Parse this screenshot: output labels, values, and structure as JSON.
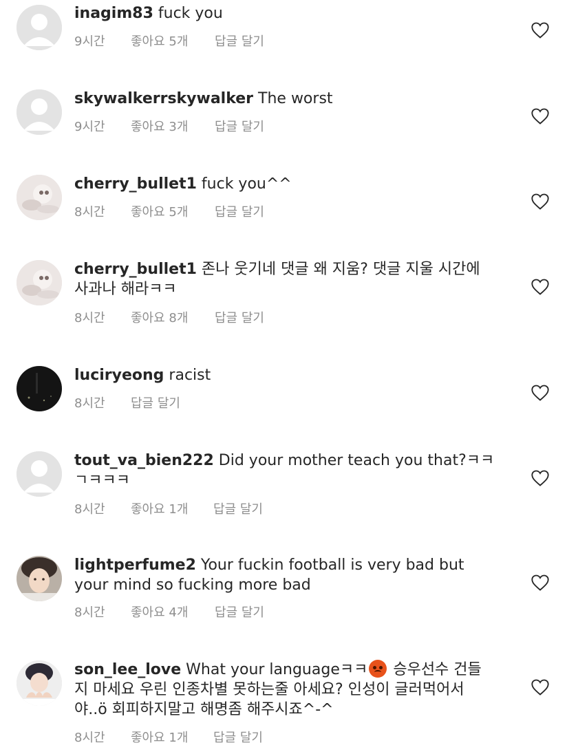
{
  "comments": [
    {
      "username": "inagim83",
      "text": "fuck you",
      "time": "9시간",
      "likes": "좋아요 5개",
      "reply": "답글 달기",
      "avatar": "default"
    },
    {
      "username": "skywalkerrskywalker",
      "text": "The worst",
      "time": "9시간",
      "likes": "좋아요 3개",
      "reply": "답글 달기",
      "avatar": "default"
    },
    {
      "username": "cherry_bullet1",
      "text": "fuck you^^",
      "time": "8시간",
      "likes": "좋아요 5개",
      "reply": "답글 달기",
      "avatar": "photo-light"
    },
    {
      "username": "cherry_bullet1",
      "text": "존나 웃기네 댓글 왜 지움? 댓글 지울 시간에",
      "text2": "사과나 해라ㅋㅋ",
      "time": "8시간",
      "likes": "좋아요 8개",
      "reply": "답글 달기",
      "avatar": "photo-light"
    },
    {
      "username": "luciryeong",
      "text": "racist",
      "time": "8시간",
      "likes": "",
      "reply": "답글 달기",
      "avatar": "photo-dark"
    },
    {
      "username": "tout_va_bien222",
      "text": "Did your mother teach you that?ㅋㅋ",
      "text2": "ㄱㅋㅋㅋ",
      "time": "8시간",
      "likes": "좋아요 1개",
      "reply": "답글 달기",
      "avatar": "default"
    },
    {
      "username": "lightperfume2",
      "text": "Your fuckin football is very bad but",
      "text2": "your mind so fucking more bad",
      "time": "8시간",
      "likes": "좋아요 4개",
      "reply": "답글 달기",
      "avatar": "photo-face"
    },
    {
      "username": "son_lee_love",
      "text": "What your languageㅋㅋ",
      "text_after_emoji": " 승우선수 건들",
      "text2": "지 마세요 우린 인종차별 못하는줄 아세요? 인성이 글러먹어서",
      "text3": "야..ö 회피하지말고 해명좀 해주시죠^-^",
      "emoji": "angry-face-emoji",
      "time": "8시간",
      "likes": "좋아요 1개",
      "reply": "답글 달기",
      "avatar": "photo-hands"
    }
  ]
}
